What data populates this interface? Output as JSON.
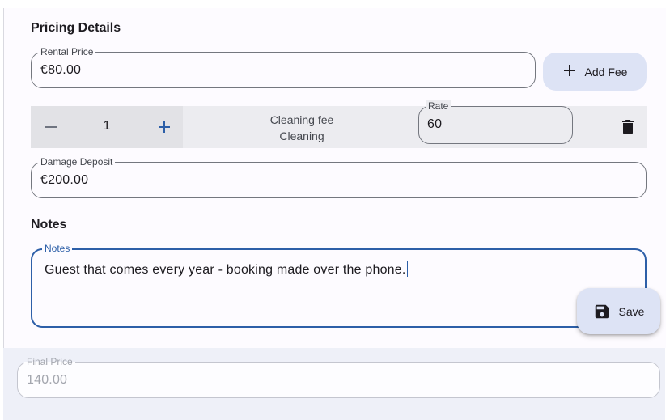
{
  "pricing": {
    "section_title": "Pricing Details",
    "rental_price": {
      "label": "Rental Price",
      "value": "€80.00"
    },
    "add_fee_label": "Add Fee"
  },
  "fee": {
    "quantity": "1",
    "name": "Cleaning fee",
    "type": "Cleaning",
    "rate_label": "Rate",
    "rate_value": "60"
  },
  "damage_deposit": {
    "label": "Damage Deposit",
    "value": "€200.00"
  },
  "notes": {
    "section_title": "Notes",
    "label": "Notes",
    "value": "Guest that comes every year - booking made over the phone."
  },
  "save_label": "Save",
  "final_price": {
    "label": "Final Price",
    "value": "140.00"
  },
  "colors": {
    "accent": "#2d5fa8",
    "button_bg": "#dde3f5",
    "fee_row_bg": "#ececf0",
    "bottom_bar_bg": "#eef0f8"
  },
  "icons": {
    "add": "plus-icon",
    "decrement": "minus-icon",
    "increment": "plus-icon",
    "delete": "trash-icon",
    "save": "floppy-disk-icon"
  }
}
